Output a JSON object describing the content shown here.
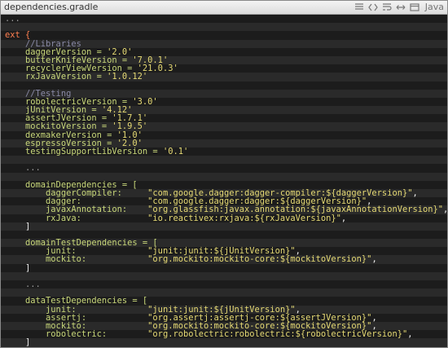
{
  "title": "dependencies.gradle",
  "language": "Java",
  "icons": [
    "lines-icon",
    "code-icon",
    "wrap-icon",
    "expand-icon",
    "window-icon"
  ],
  "lines": [
    {
      "segments": [
        {
          "text": "...",
          "cls": "dots"
        }
      ]
    },
    {
      "segments": [
        {
          "text": "",
          "cls": "plain"
        }
      ]
    },
    {
      "segments": [
        {
          "text": "ext {",
          "cls": "kw"
        }
      ]
    },
    {
      "segments": [
        {
          "text": "    //Libraries",
          "cls": "comment"
        }
      ]
    },
    {
      "segments": [
        {
          "text": "    daggerVersion = ",
          "cls": "key"
        },
        {
          "text": "'2.0'",
          "cls": "str"
        }
      ]
    },
    {
      "segments": [
        {
          "text": "    butterKnifeVersion = ",
          "cls": "key"
        },
        {
          "text": "'7.0.1'",
          "cls": "str"
        }
      ]
    },
    {
      "segments": [
        {
          "text": "    recyclerViewVersion = ",
          "cls": "key"
        },
        {
          "text": "'21.0.3'",
          "cls": "str"
        }
      ]
    },
    {
      "segments": [
        {
          "text": "    rxJavaVersion = ",
          "cls": "key"
        },
        {
          "text": "'1.0.12'",
          "cls": "str"
        }
      ]
    },
    {
      "segments": [
        {
          "text": "",
          "cls": "plain"
        }
      ]
    },
    {
      "segments": [
        {
          "text": "    //Testing",
          "cls": "comment"
        }
      ]
    },
    {
      "segments": [
        {
          "text": "    robolectricVersion = ",
          "cls": "key"
        },
        {
          "text": "'3.0'",
          "cls": "str"
        }
      ]
    },
    {
      "segments": [
        {
          "text": "    jUnitVersion = ",
          "cls": "key"
        },
        {
          "text": "'4.12'",
          "cls": "str"
        }
      ]
    },
    {
      "segments": [
        {
          "text": "    assertJVersion = ",
          "cls": "key"
        },
        {
          "text": "'1.7.1'",
          "cls": "str"
        }
      ]
    },
    {
      "segments": [
        {
          "text": "    mockitoVersion = ",
          "cls": "key"
        },
        {
          "text": "'1.9.5'",
          "cls": "str"
        }
      ]
    },
    {
      "segments": [
        {
          "text": "    dexmakerVersion = ",
          "cls": "key"
        },
        {
          "text": "'1.0'",
          "cls": "str"
        }
      ]
    },
    {
      "segments": [
        {
          "text": "    espressoVersion = ",
          "cls": "key"
        },
        {
          "text": "'2.0'",
          "cls": "str"
        }
      ]
    },
    {
      "segments": [
        {
          "text": "    testingSupportLibVersion = ",
          "cls": "key"
        },
        {
          "text": "'0.1'",
          "cls": "str"
        }
      ]
    },
    {
      "segments": [
        {
          "text": "",
          "cls": "plain"
        }
      ]
    },
    {
      "segments": [
        {
          "text": "    ...",
          "cls": "dots"
        }
      ]
    },
    {
      "segments": [
        {
          "text": "",
          "cls": "plain"
        }
      ]
    },
    {
      "segments": [
        {
          "text": "    domainDependencies = [",
          "cls": "key"
        }
      ]
    },
    {
      "segments": [
        {
          "text": "        daggerCompiler:     ",
          "cls": "key"
        },
        {
          "text": "\"com.google.dagger:dagger-compiler:${daggerVersion}\"",
          "cls": "str"
        },
        {
          "text": ",",
          "cls": "plain"
        }
      ]
    },
    {
      "segments": [
        {
          "text": "        dagger:             ",
          "cls": "key"
        },
        {
          "text": "\"com.google.dagger:dagger:${daggerVersion}\"",
          "cls": "str"
        },
        {
          "text": ",",
          "cls": "plain"
        }
      ]
    },
    {
      "segments": [
        {
          "text": "        javaxAnnotation:    ",
          "cls": "key"
        },
        {
          "text": "\"org.glassfish:javax.annotation:${javaxAnnotationVersion}\"",
          "cls": "str"
        },
        {
          "text": ",",
          "cls": "plain"
        }
      ]
    },
    {
      "segments": [
        {
          "text": "        rxJava:             ",
          "cls": "key"
        },
        {
          "text": "\"io.reactivex:rxjava:${rxJavaVersion}\"",
          "cls": "str"
        },
        {
          "text": ",",
          "cls": "plain"
        }
      ]
    },
    {
      "segments": [
        {
          "text": "    ]",
          "cls": "plain"
        }
      ]
    },
    {
      "segments": [
        {
          "text": "",
          "cls": "plain"
        }
      ]
    },
    {
      "segments": [
        {
          "text": "    domainTestDependencies = [",
          "cls": "key"
        }
      ]
    },
    {
      "segments": [
        {
          "text": "        junit:              ",
          "cls": "key"
        },
        {
          "text": "\"junit:junit:${jUnitVersion}\"",
          "cls": "str"
        },
        {
          "text": ",",
          "cls": "plain"
        }
      ]
    },
    {
      "segments": [
        {
          "text": "        mockito:            ",
          "cls": "key"
        },
        {
          "text": "\"org.mockito:mockito-core:${mockitoVersion}\"",
          "cls": "str"
        },
        {
          "text": ",",
          "cls": "plain"
        }
      ]
    },
    {
      "segments": [
        {
          "text": "    ]",
          "cls": "plain"
        }
      ]
    },
    {
      "segments": [
        {
          "text": "",
          "cls": "plain"
        }
      ]
    },
    {
      "segments": [
        {
          "text": "    ...",
          "cls": "dots"
        }
      ]
    },
    {
      "segments": [
        {
          "text": "",
          "cls": "plain"
        }
      ]
    },
    {
      "segments": [
        {
          "text": "    dataTestDependencies = [",
          "cls": "key"
        }
      ]
    },
    {
      "segments": [
        {
          "text": "        junit:              ",
          "cls": "key"
        },
        {
          "text": "\"junit:junit:${jUnitVersion}\"",
          "cls": "str"
        },
        {
          "text": ",",
          "cls": "plain"
        }
      ]
    },
    {
      "segments": [
        {
          "text": "        assertj:            ",
          "cls": "key"
        },
        {
          "text": "\"org.assertj:assertj-core:${assertJVersion}\"",
          "cls": "str"
        },
        {
          "text": ",",
          "cls": "plain"
        }
      ]
    },
    {
      "segments": [
        {
          "text": "        mockito:            ",
          "cls": "key"
        },
        {
          "text": "\"org.mockito:mockito-core:${mockitoVersion}\"",
          "cls": "str"
        },
        {
          "text": ",",
          "cls": "plain"
        }
      ]
    },
    {
      "segments": [
        {
          "text": "        robolectric:        ",
          "cls": "key"
        },
        {
          "text": "\"org.robolectric:robolectric:${robolectricVersion}\"",
          "cls": "str"
        },
        {
          "text": ",",
          "cls": "plain"
        }
      ]
    },
    {
      "segments": [
        {
          "text": "    ]",
          "cls": "plain"
        }
      ]
    },
    {
      "segments": [
        {
          "text": "}",
          "cls": "kw"
        }
      ]
    }
  ]
}
